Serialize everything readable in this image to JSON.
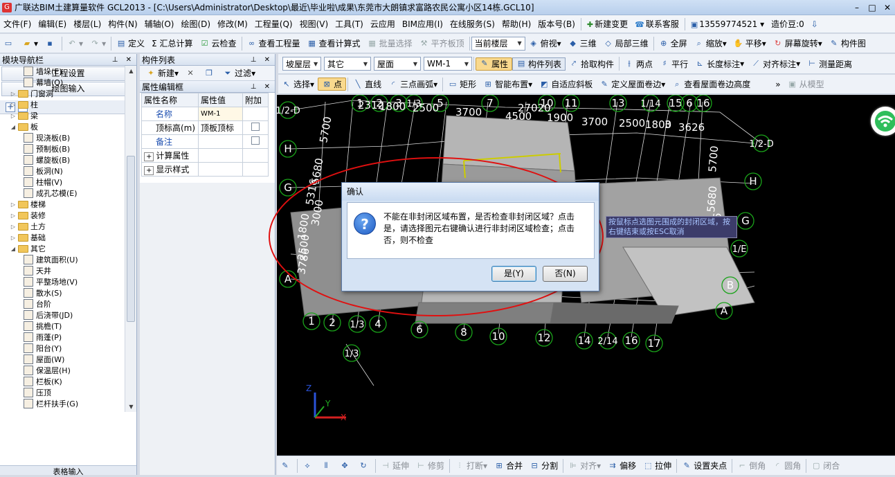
{
  "window": {
    "title": "广联达BIM土建算量软件 GCL2013 - [C:\\Users\\Administrator\\Desktop\\最近\\毕业啦\\成果\\东莞市大朗镇求富路农民公寓小区14栋.GCL10]",
    "min": "–",
    "max": "□",
    "close": "✕"
  },
  "menubar": {
    "items": [
      "文件(F)",
      "编辑(E)",
      "楼层(L)",
      "构件(N)",
      "辅轴(O)",
      "绘图(D)",
      "修改(M)",
      "工程量(Q)",
      "视图(V)",
      "工具(T)",
      "云应用",
      "BIM应用(I)",
      "在线服务(S)",
      "帮助(H)",
      "版本号(B)"
    ],
    "new_change": "新建变更",
    "support": "联系客服",
    "phone": "13559774521",
    "cost_beans": "造价豆:0"
  },
  "toolbar1": {
    "define": "定义",
    "sum_calc": "Σ 汇总计算",
    "cloud_check": "云检查",
    "view_qty": "查看工程量",
    "view_formula": "查看计算式",
    "batch_select": "批量选择",
    "flush_slab": "平齐板顶",
    "floor_combo": "当前楼层",
    "top_view": "俯视",
    "three_d": "三维",
    "local_3d": "局部三维",
    "fullscreen": "全屏",
    "zoom": "缩放",
    "pan": "平移",
    "rotate": "屏幕旋转",
    "component_view": "构件图"
  },
  "left_panel": {
    "header": "模块导航栏",
    "project_settings": "工程设置",
    "drawing_input": "绘图输入",
    "table_input": "表格输入",
    "tree": [
      {
        "label": "墙垛(E)",
        "level": 2,
        "type": "leaf",
        "icon": "wall-pier"
      },
      {
        "label": "幕墙(Q)",
        "level": 2,
        "type": "leaf",
        "icon": "curtain-wall"
      },
      {
        "label": "门窗洞",
        "level": 1,
        "type": "folder",
        "expanded": false
      },
      {
        "label": "柱",
        "level": 1,
        "type": "folder",
        "expanded": false
      },
      {
        "label": "梁",
        "level": 1,
        "type": "folder",
        "expanded": false
      },
      {
        "label": "板",
        "level": 1,
        "type": "folder",
        "expanded": true
      },
      {
        "label": "现浇板(B)",
        "level": 2,
        "type": "leaf",
        "icon": "cast-slab"
      },
      {
        "label": "预制板(B)",
        "level": 2,
        "type": "leaf",
        "icon": "precast-slab"
      },
      {
        "label": "螺旋板(B)",
        "level": 2,
        "type": "leaf",
        "icon": "spiral-slab"
      },
      {
        "label": "板洞(N)",
        "level": 2,
        "type": "leaf",
        "icon": "slab-hole"
      },
      {
        "label": "柱帽(V)",
        "level": 2,
        "type": "leaf",
        "icon": "column-cap"
      },
      {
        "label": "成孔芯模(E)",
        "level": 2,
        "type": "leaf",
        "icon": "core-mold"
      },
      {
        "label": "楼梯",
        "level": 1,
        "type": "folder",
        "expanded": false
      },
      {
        "label": "装修",
        "level": 1,
        "type": "folder",
        "expanded": false
      },
      {
        "label": "土方",
        "level": 1,
        "type": "folder",
        "expanded": false
      },
      {
        "label": "基础",
        "level": 1,
        "type": "folder",
        "expanded": false
      },
      {
        "label": "其它",
        "level": 1,
        "type": "folder",
        "expanded": true
      },
      {
        "label": "建筑面积(U)",
        "level": 2,
        "type": "leaf",
        "icon": "building-area"
      },
      {
        "label": "天井",
        "level": 2,
        "type": "leaf",
        "icon": "patio"
      },
      {
        "label": "平整场地(V)",
        "level": 2,
        "type": "leaf",
        "icon": "site-leveling"
      },
      {
        "label": "散水(S)",
        "level": 2,
        "type": "leaf",
        "icon": "apron"
      },
      {
        "label": "台阶",
        "level": 2,
        "type": "leaf",
        "icon": "steps"
      },
      {
        "label": "后浇带(JD)",
        "level": 2,
        "type": "leaf",
        "icon": "post-pour-strip"
      },
      {
        "label": "挑檐(T)",
        "level": 2,
        "type": "leaf",
        "icon": "overhang"
      },
      {
        "label": "雨蓬(P)",
        "level": 2,
        "type": "leaf",
        "icon": "canopy"
      },
      {
        "label": "阳台(Y)",
        "level": 2,
        "type": "leaf",
        "icon": "balcony"
      },
      {
        "label": "屋面(W)",
        "level": 2,
        "type": "leaf",
        "icon": "roof"
      },
      {
        "label": "保温层(H)",
        "level": 2,
        "type": "leaf",
        "icon": "insulation"
      },
      {
        "label": "栏板(K)",
        "level": 2,
        "type": "leaf",
        "icon": "parapet-panel"
      },
      {
        "label": "压顶",
        "level": 2,
        "type": "leaf",
        "icon": "coping"
      },
      {
        "label": "栏杆扶手(G)",
        "level": 2,
        "type": "leaf",
        "icon": "railing"
      }
    ]
  },
  "mid_panel": {
    "component_list": "构件列表",
    "new": "新建",
    "filter": "过滤",
    "prop_editor": "属性编辑框",
    "col_name": "属性名称",
    "col_value": "属性值",
    "col_extra": "附加",
    "rows": [
      {
        "name": "名称",
        "value": "WM-1",
        "has_check": false
      },
      {
        "name": "顶标高(m)",
        "value": "顶板顶标",
        "has_check": true
      },
      {
        "name": "备注",
        "value": "",
        "has_check": true
      }
    ],
    "calc_props": "计算属性",
    "display_style": "显示样式"
  },
  "toolbar2": {
    "slope_layer": "坡屋层",
    "other": "其它",
    "roof": "屋面",
    "wm": "WM-1",
    "properties": "属性",
    "component_list": "构件列表",
    "pick_component": "拾取构件",
    "two_points": "两点",
    "parallel": "平行",
    "length_dim": "长度标注",
    "align_dim": "对齐标注",
    "measure_dist": "测量距离"
  },
  "toolbar3": {
    "select": "选择",
    "point": "点",
    "line": "直线",
    "three_point_arc": "三点画弧",
    "rect": "矩形",
    "smart_layout": "智能布置",
    "adaptive_slope": "自适应斜板",
    "define_roof_edge": "定义屋面卷边",
    "view_roof_edge_height": "查看屋面卷边高度",
    "from_model": "从模型"
  },
  "viewport": {
    "axis_top": [
      "1",
      "2",
      "3",
      "1/3",
      "5",
      "7",
      "10",
      "11",
      "13",
      "1/14",
      "15",
      "6",
      "16"
    ],
    "axis_bottom": [
      "1",
      "2",
      "1/3",
      "4",
      "6",
      "8",
      "10",
      "12",
      "14",
      "2/14",
      "16",
      "17",
      "1/3"
    ],
    "axis_left": [
      "1/2-D",
      "H",
      "G",
      "A"
    ],
    "axis_right": [
      "1/2-D",
      "H",
      "G",
      "1/E",
      "B",
      "A"
    ],
    "dims_top": [
      "2312",
      "1800",
      "2500",
      "3700",
      "27020",
      "4500",
      "1900",
      "3700",
      "2500",
      "1800",
      "3",
      "3626"
    ],
    "dims_left": [
      "5700",
      "5680",
      "5316",
      "3000",
      "1800",
      "2500",
      "3786"
    ],
    "dims_right": [
      "5700",
      "5680",
      "16"
    ],
    "coord_z": "Z",
    "coord_y": "Y",
    "coord_x": "X",
    "tooltip": "按鼠标点选图元围成的封闭区域，按右键结束或按ESC取消"
  },
  "dialog": {
    "title": "确认",
    "icon": "question-icon",
    "message": "不能在非封闭区域布置，是否检查非封闭区域？点击是，请选择图元右键确认进行非封闭区域检查；点击否，则不检查",
    "yes": "是(Y)",
    "no": "否(N)"
  },
  "bottombar": {
    "extend": "延伸",
    "trim": "修剪",
    "break": "打断",
    "merge": "合并",
    "split": "分割",
    "align": "对齐",
    "offset": "偏移",
    "stretch": "拉伸",
    "set_point": "设置夹点",
    "chamfer": "倒角",
    "fillet": "圆角",
    "close": "闭合"
  },
  "colors": {
    "viewport_bg": "#000000",
    "axis_green": "#1aa31a",
    "grid_white": "#ffffff",
    "highlight_ellipse": "#e01010",
    "prop_header": "#f5c978"
  }
}
